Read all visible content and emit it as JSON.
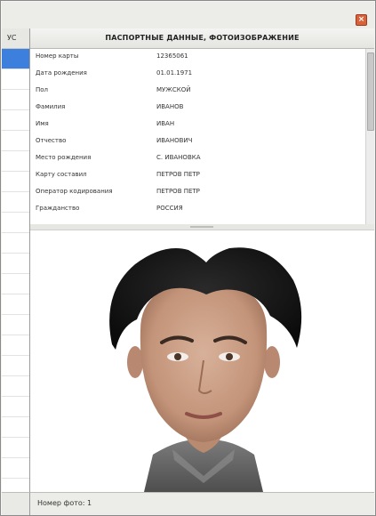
{
  "window": {
    "close_glyph": "×"
  },
  "left_panel": {
    "header_label": "УС"
  },
  "panel_title": "ПАСПОРТНЫЕ ДАННЫЕ, ФОТОИЗОБРАЖЕНИЕ",
  "fields": [
    {
      "label": "Номер карты",
      "value": "12365061"
    },
    {
      "label": "Дата рождения",
      "value": "01.01.1971"
    },
    {
      "label": "Пол",
      "value": "МУЖСКОЙ"
    },
    {
      "label": "Фамилия",
      "value": "ИВАНОВ"
    },
    {
      "label": "Имя",
      "value": "ИВАН"
    },
    {
      "label": "Отчество",
      "value": "ИВАНОВИЧ"
    },
    {
      "label": "Место рождения",
      "value": "С. ИВАНОВКА"
    },
    {
      "label": "Карту составил",
      "value": "ПЕТРОВ ПЕТР"
    },
    {
      "label": "Оператор кодирования",
      "value": "ПЕТРОВ ПЕТР"
    },
    {
      "label": "Гражданство",
      "value": "РОССИЯ"
    }
  ],
  "status": {
    "text": "Номер фото: 1"
  },
  "colors": {
    "selection": "#3d7fdc",
    "close_button": "#d9623a",
    "hair": "#161616",
    "skin": "#caa189",
    "shirt": "#6a6a6a"
  }
}
